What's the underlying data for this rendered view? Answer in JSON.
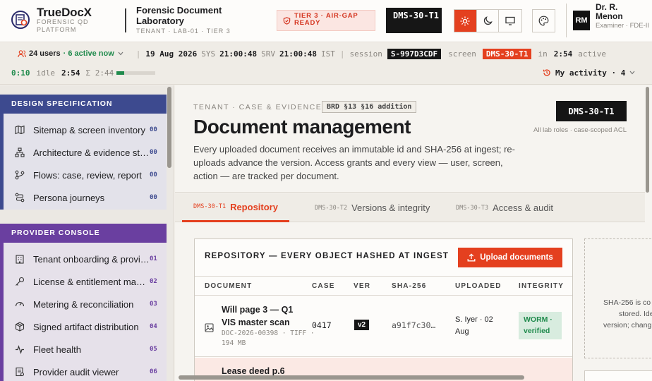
{
  "header": {
    "brand_name": "TrueDocX",
    "brand_sub": "FORENSIC QD PLATFORM",
    "lab_name": "Forensic Document Laboratory",
    "lab_sub": "TENANT · LAB-01 · TIER 3",
    "tier_badge": "TIER 3 · AIR-GAP READY",
    "screen_code": "DMS-30-T1",
    "user_initials": "RM",
    "user_name": "Dr. R. Menon",
    "user_role": "Examiner · FDE-II",
    "theme_active": "light"
  },
  "status": {
    "users": "24 users",
    "active": "· 6 active now",
    "date": "19 Aug 2026",
    "sys_label": "SYS",
    "sys_time": "21:00:48",
    "srv_label": "SRV",
    "srv_time": "21:00:48",
    "tz": "IST",
    "session_label": "session",
    "session_id": "S-997D3CDF",
    "screen_label": "screen",
    "screen_id": "DMS-30-T1",
    "in_label": "in",
    "in_time": "2:54",
    "active_label": "active",
    "active_time": "0:10",
    "idle_label": "idle",
    "idle_time": "2:54",
    "sigma_label": "Σ 2:44",
    "activity_progress": 0.2,
    "my_activity": "My activity · 4"
  },
  "sidebar": {
    "design": {
      "title": "DESIGN SPECIFICATION",
      "items": [
        {
          "label": "Sitemap & screen inventory",
          "num": "00",
          "icon": "map-icon"
        },
        {
          "label": "Architecture & evidence store",
          "num": "00",
          "icon": "architecture-icon"
        },
        {
          "label": "Flows: case, review, report",
          "num": "00",
          "icon": "flow-icon"
        },
        {
          "label": "Persona journeys",
          "num": "00",
          "icon": "persona-icon"
        }
      ]
    },
    "provider": {
      "title": "PROVIDER CONSOLE",
      "items": [
        {
          "label": "Tenant onboarding & provisioning",
          "num": "01",
          "icon": "building-icon"
        },
        {
          "label": "License & entitlement management",
          "num": "02",
          "icon": "key-icon"
        },
        {
          "label": "Metering & reconciliation",
          "num": "03",
          "icon": "gauge-icon"
        },
        {
          "label": "Signed artifact distribution",
          "num": "04",
          "icon": "package-icon"
        },
        {
          "label": "Fleet health",
          "num": "05",
          "icon": "pulse-icon"
        },
        {
          "label": "Provider audit viewer",
          "num": "06",
          "icon": "audit-icon"
        }
      ]
    }
  },
  "page": {
    "eyebrow": "TENANT · CASE & EVIDENCE",
    "brd_chip": "BRD §13 §16 addition",
    "title": "Document management",
    "description": "Every uploaded document receives an immutable id and SHA-256 at ingest; re-uploads advance the version. Access grants and every view — user, screen, action — are tracked per document.",
    "code": "DMS-30-T1",
    "code_note": "All lab roles · case-scoped ACL"
  },
  "tabs": [
    {
      "code": "DMS-30-T1",
      "label": "Repository"
    },
    {
      "code": "DMS-30-T2",
      "label": "Versions & integrity"
    },
    {
      "code": "DMS-30-T3",
      "label": "Access & audit"
    }
  ],
  "repository": {
    "title": "REPOSITORY — EVERY OBJECT HASHED AT INGEST",
    "upload_label": "Upload documents",
    "columns": [
      "DOCUMENT",
      "CASE",
      "VER",
      "SHA-256",
      "UPLOADED",
      "INTEGRITY"
    ],
    "rows": [
      {
        "title": "Will page 3 — Q1 VIS master scan",
        "meta": "DOC-2026-00398 · TIFF · 194 MB",
        "case": "0417",
        "ver": "v2",
        "sha": "a91f7c30…",
        "uploaded": "S. Iyer · 02 Aug",
        "integrity": "WORM · verified"
      },
      {
        "title": "Lease deed p.6",
        "meta": "",
        "case": "",
        "ver": "",
        "sha": "",
        "uploaded": "",
        "integrity": ""
      }
    ]
  },
  "side_note": {
    "lines": [
      "SHA-256 is co",
      "stored. Iden",
      "version; chang"
    ]
  }
}
